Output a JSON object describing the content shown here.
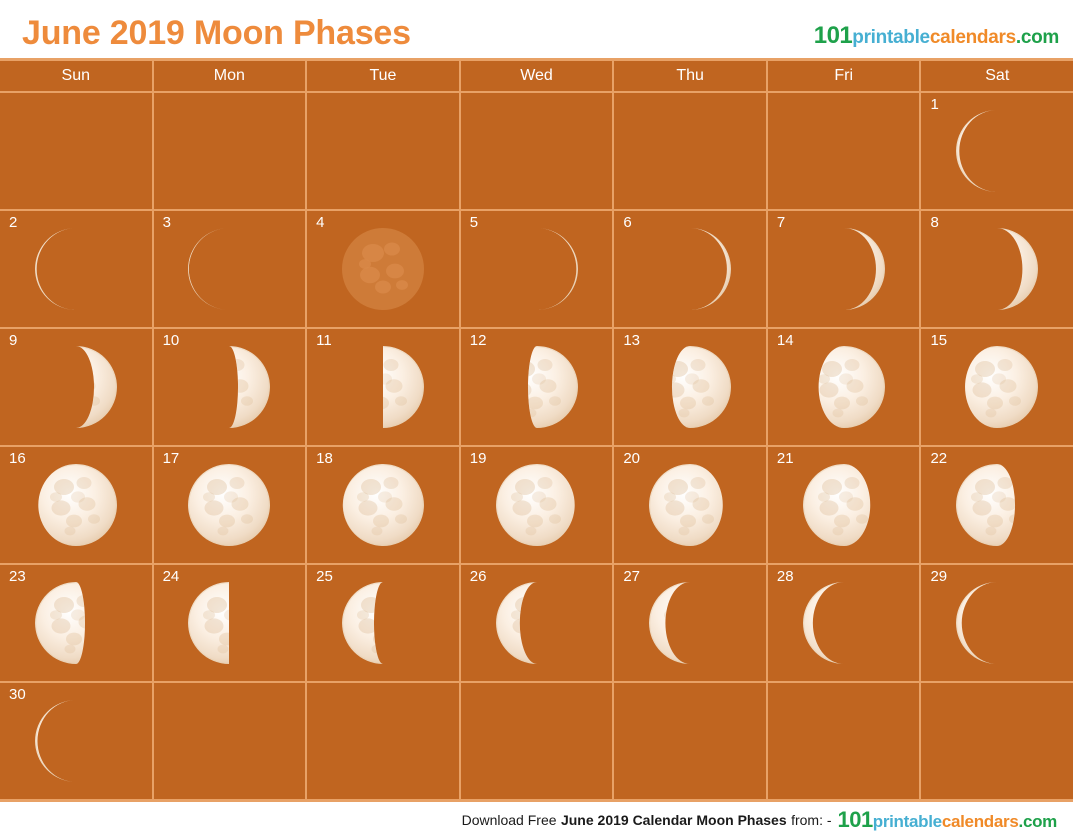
{
  "header": {
    "title": "June 2019 Moon Phases",
    "title_color": "#EE8B3C",
    "brand": {
      "part1": "101",
      "part1_color": "#1EA14A",
      "part2": "printable",
      "part2_color": "#46AFD2",
      "part3": "calendars",
      "part3_color": "#F08A28",
      "part4": ".com",
      "part4_color": "#1EA14A"
    }
  },
  "calendar": {
    "background_color": "#C06520",
    "gridline_color": "#E8A166",
    "text_color": "#FFFFFF",
    "weekdays": [
      "Sun",
      "Mon",
      "Tue",
      "Wed",
      "Thu",
      "Fri",
      "Sat"
    ],
    "weeks": [
      [
        {
          "day": "",
          "phase": null,
          "illum": null
        },
        {
          "day": "",
          "phase": null,
          "illum": null
        },
        {
          "day": "",
          "phase": null,
          "illum": null
        },
        {
          "day": "",
          "phase": null,
          "illum": null
        },
        {
          "day": "",
          "phase": null,
          "illum": null
        },
        {
          "day": "",
          "phase": null,
          "illum": null
        },
        {
          "day": "1",
          "phase": "waning-crescent",
          "illum": 4
        }
      ],
      [
        {
          "day": "2",
          "phase": "waning-crescent",
          "illum": 2
        },
        {
          "day": "3",
          "phase": "waning-crescent",
          "illum": 1
        },
        {
          "day": "4",
          "phase": "new-moon",
          "illum": 0
        },
        {
          "day": "5",
          "phase": "waxing-crescent",
          "illum": 2
        },
        {
          "day": "6",
          "phase": "waxing-crescent",
          "illum": 5
        },
        {
          "day": "7",
          "phase": "waxing-crescent",
          "illum": 11
        },
        {
          "day": "8",
          "phase": "waxing-crescent",
          "illum": 19
        }
      ],
      [
        {
          "day": "9",
          "phase": "waxing-crescent",
          "illum": 28
        },
        {
          "day": "10",
          "phase": "first-quarter",
          "illum": 39
        },
        {
          "day": "11",
          "phase": "first-quarter",
          "illum": 50
        },
        {
          "day": "12",
          "phase": "waxing-gibbous",
          "illum": 61
        },
        {
          "day": "13",
          "phase": "waxing-gibbous",
          "illum": 72
        },
        {
          "day": "14",
          "phase": "waxing-gibbous",
          "illum": 81
        },
        {
          "day": "15",
          "phase": "waxing-gibbous",
          "illum": 89
        }
      ],
      [
        {
          "day": "16",
          "phase": "waxing-gibbous",
          "illum": 96
        },
        {
          "day": "17",
          "phase": "full-moon",
          "illum": 100
        },
        {
          "day": "18",
          "phase": "full-moon",
          "illum": 99
        },
        {
          "day": "19",
          "phase": "waning-gibbous",
          "illum": 96
        },
        {
          "day": "20",
          "phase": "waning-gibbous",
          "illum": 90
        },
        {
          "day": "21",
          "phase": "waning-gibbous",
          "illum": 82
        },
        {
          "day": "22",
          "phase": "waning-gibbous",
          "illum": 72
        }
      ],
      [
        {
          "day": "23",
          "phase": "waning-gibbous",
          "illum": 61
        },
        {
          "day": "24",
          "phase": "last-quarter",
          "illum": 50
        },
        {
          "day": "25",
          "phase": "last-quarter",
          "illum": 39
        },
        {
          "day": "26",
          "phase": "waning-crescent",
          "illum": 29
        },
        {
          "day": "27",
          "phase": "waning-crescent",
          "illum": 20
        },
        {
          "day": "28",
          "phase": "waning-crescent",
          "illum": 12
        },
        {
          "day": "29",
          "phase": "waning-crescent",
          "illum": 7
        }
      ],
      [
        {
          "day": "30",
          "phase": "waning-crescent",
          "illum": 3
        },
        {
          "day": "",
          "phase": null,
          "illum": null
        },
        {
          "day": "",
          "phase": null,
          "illum": null
        },
        {
          "day": "",
          "phase": null,
          "illum": null
        },
        {
          "day": "",
          "phase": null,
          "illum": null
        },
        {
          "day": "",
          "phase": null,
          "illum": null
        },
        {
          "day": "",
          "phase": null,
          "illum": null
        }
      ]
    ]
  },
  "footer": {
    "prefix": "Download Free",
    "emphasis": "June 2019 Calendar Moon Phases",
    "suffix": "from: -",
    "brand": {
      "part1": "101",
      "part2": "printable",
      "part3": "calendars",
      "part4": ".com"
    }
  }
}
